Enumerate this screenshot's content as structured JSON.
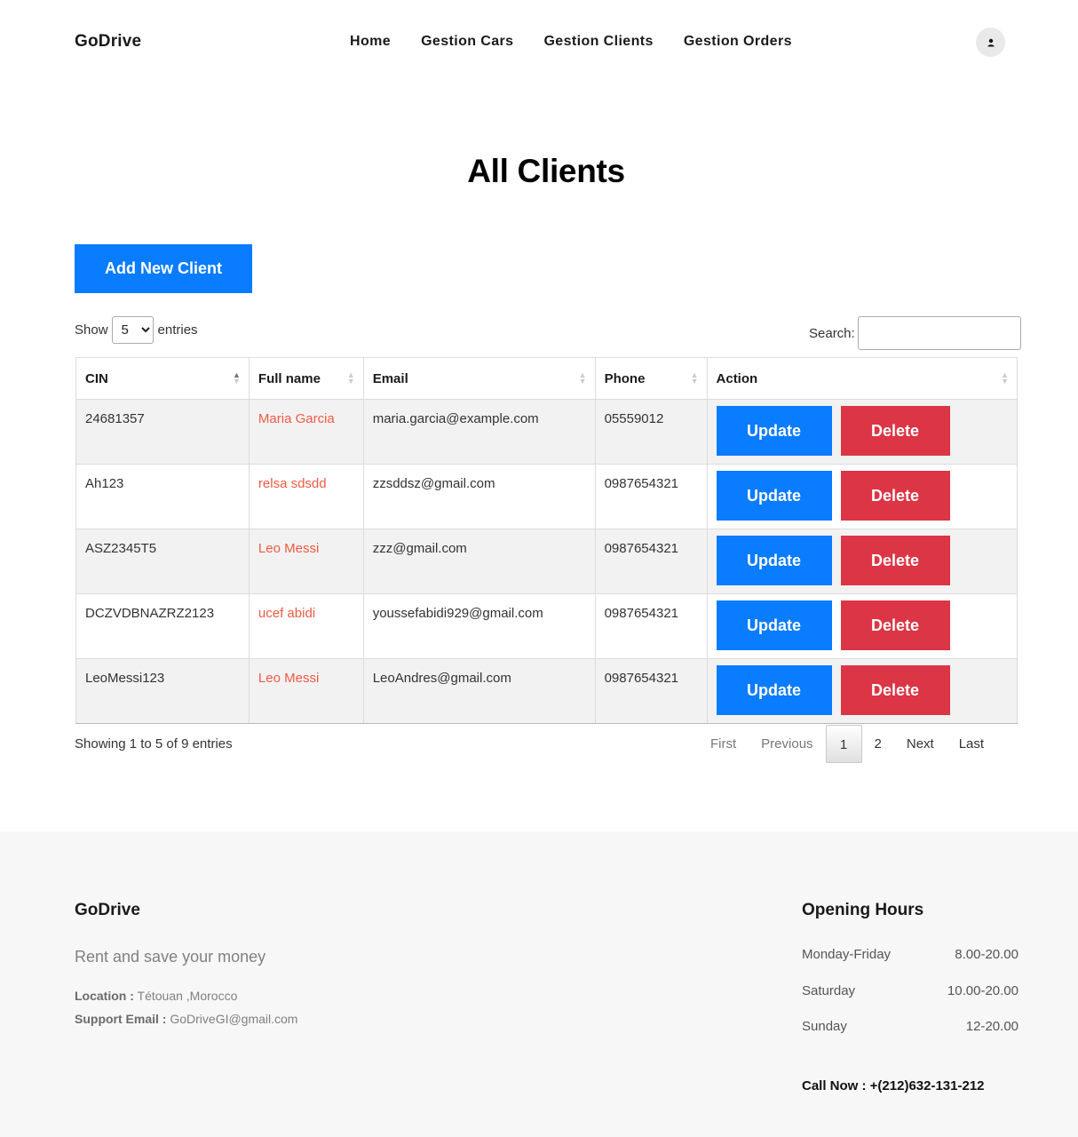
{
  "header": {
    "brand": "GoDrive",
    "nav": [
      "Home",
      "Gestion Cars",
      "Gestion Clients",
      "Gestion Orders"
    ]
  },
  "page": {
    "title": "All Clients",
    "add_button": "Add New Client"
  },
  "datatable": {
    "show_label": "Show",
    "entries_label": "entries",
    "length_value": "5",
    "search_label": "Search:",
    "search_value": "",
    "columns": [
      "CIN",
      "Full name",
      "Email",
      "Phone",
      "Action"
    ],
    "sorted_column": "CIN",
    "rows": [
      {
        "cin": "24681357",
        "name": "Maria Garcia",
        "email": "maria.garcia@example.com",
        "phone": "05559012"
      },
      {
        "cin": "Ah123",
        "name": "relsa sdsdd",
        "email": "zzsddsz@gmail.com",
        "phone": "0987654321"
      },
      {
        "cin": "ASZ2345T5",
        "name": "Leo Messi",
        "email": "zzz@gmail.com",
        "phone": "0987654321"
      },
      {
        "cin": "DCZVDBNAZRZ2123",
        "name": "ucef abidi",
        "email": "youssefabidi929@gmail.com",
        "phone": "0987654321"
      },
      {
        "cin": "LeoMessi123",
        "name": "Leo Messi",
        "email": "LeoAndres@gmail.com",
        "phone": "0987654321"
      }
    ],
    "update_label": "Update",
    "delete_label": "Delete",
    "info": "Showing 1 to 5 of 9 entries",
    "pagination": {
      "first": "First",
      "previous": "Previous",
      "pages": [
        "1",
        "2"
      ],
      "current": "1",
      "next": "Next",
      "last": "Last"
    }
  },
  "footer": {
    "brand": "GoDrive",
    "tagline": "Rent and save your money",
    "location_label": "Location :",
    "location": "Tétouan ,Morocco",
    "email_label": "Support Email :",
    "email": "GoDriveGI@gmail.com",
    "hours_title": "Opening Hours",
    "hours": [
      {
        "day": "Monday-Friday",
        "time": "8.00-20.00"
      },
      {
        "day": "Saturday",
        "time": "10.00-20.00"
      },
      {
        "day": "Sunday",
        "time": "12-20.00"
      }
    ],
    "call": "Call Now : +(212)632-131-212"
  },
  "colors": {
    "primary": "#0a7cff",
    "danger": "#dc3545",
    "name_link": "#f05a44",
    "footer_bg": "#f7f7f7"
  }
}
